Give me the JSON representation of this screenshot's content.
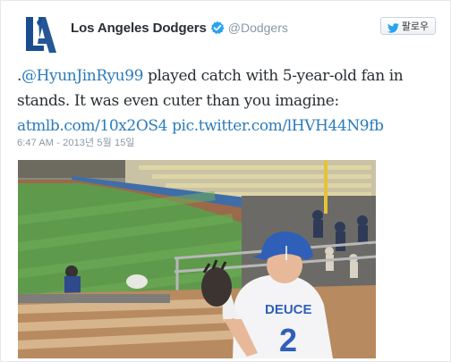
{
  "tweet": {
    "author": {
      "name": "Los Angeles Dodgers",
      "handle": "@Dodgers",
      "logo_text": "LA",
      "brand_color": "#1a4d8f",
      "verified_icon": "verified-badge-icon"
    },
    "follow_button": {
      "label": "팔로우",
      "icon": "twitter-bird-icon"
    },
    "text": {
      "prefix": ".",
      "mention": "@HyunJinRyu99",
      "line1_rest": " played catch with 5-year-old fan in",
      "line2": "stands. It was even cuter than you imagine:",
      "link1": "atmlb.com/10x2OS4",
      "link2": "pic.twitter.com/lHVH44N9fb"
    },
    "timestamp": "6:47 AM - 2013년 5월 15일",
    "media": {
      "jersey_name": "DEUCE",
      "jersey_number": "2",
      "link_color": "#2b7bb9"
    }
  }
}
